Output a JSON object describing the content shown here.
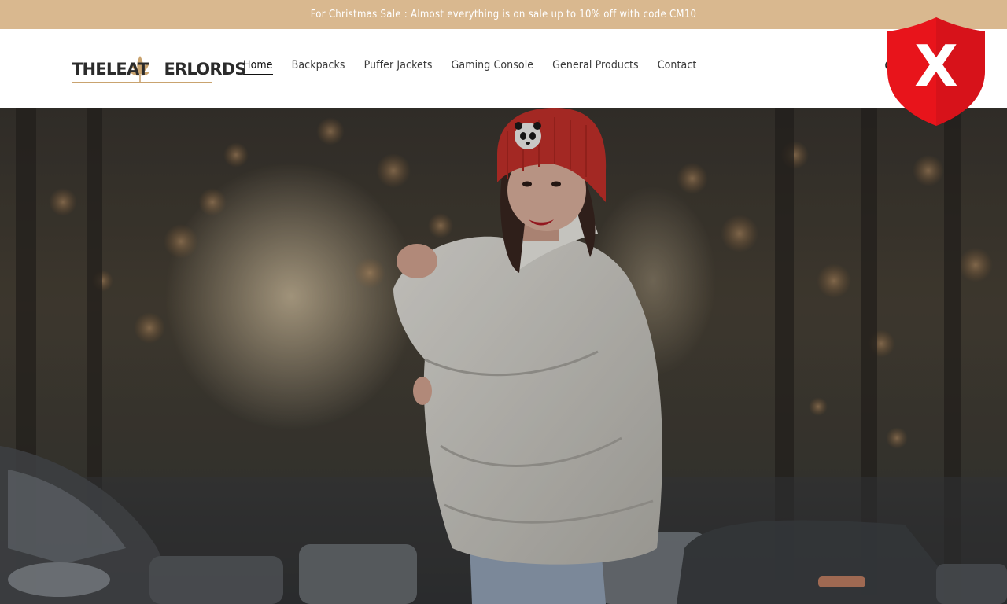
{
  "announcement": {
    "text": "For Christmas Sale : Almost everything is on sale up to 10% off with code CM10"
  },
  "header": {
    "logo_text": "THELEAT ERLORDS",
    "nav": [
      {
        "label": "Home",
        "active": true
      },
      {
        "label": "Backpacks",
        "active": false
      },
      {
        "label": "Puffer Jackets",
        "active": false
      },
      {
        "label": "Gaming Console",
        "active": false
      },
      {
        "label": "General Products",
        "active": false
      },
      {
        "label": "Contact",
        "active": false
      }
    ],
    "search_icon": "search-icon"
  },
  "hero": {
    "image": "woman-in-white-puffer-jacket-red-beanie"
  },
  "overlay": {
    "icon": "security-shield-x-icon",
    "label": "X",
    "color": "#e8141b"
  },
  "colors": {
    "announcement_bg": "#d9b88f",
    "accent": "#c9a36f"
  }
}
